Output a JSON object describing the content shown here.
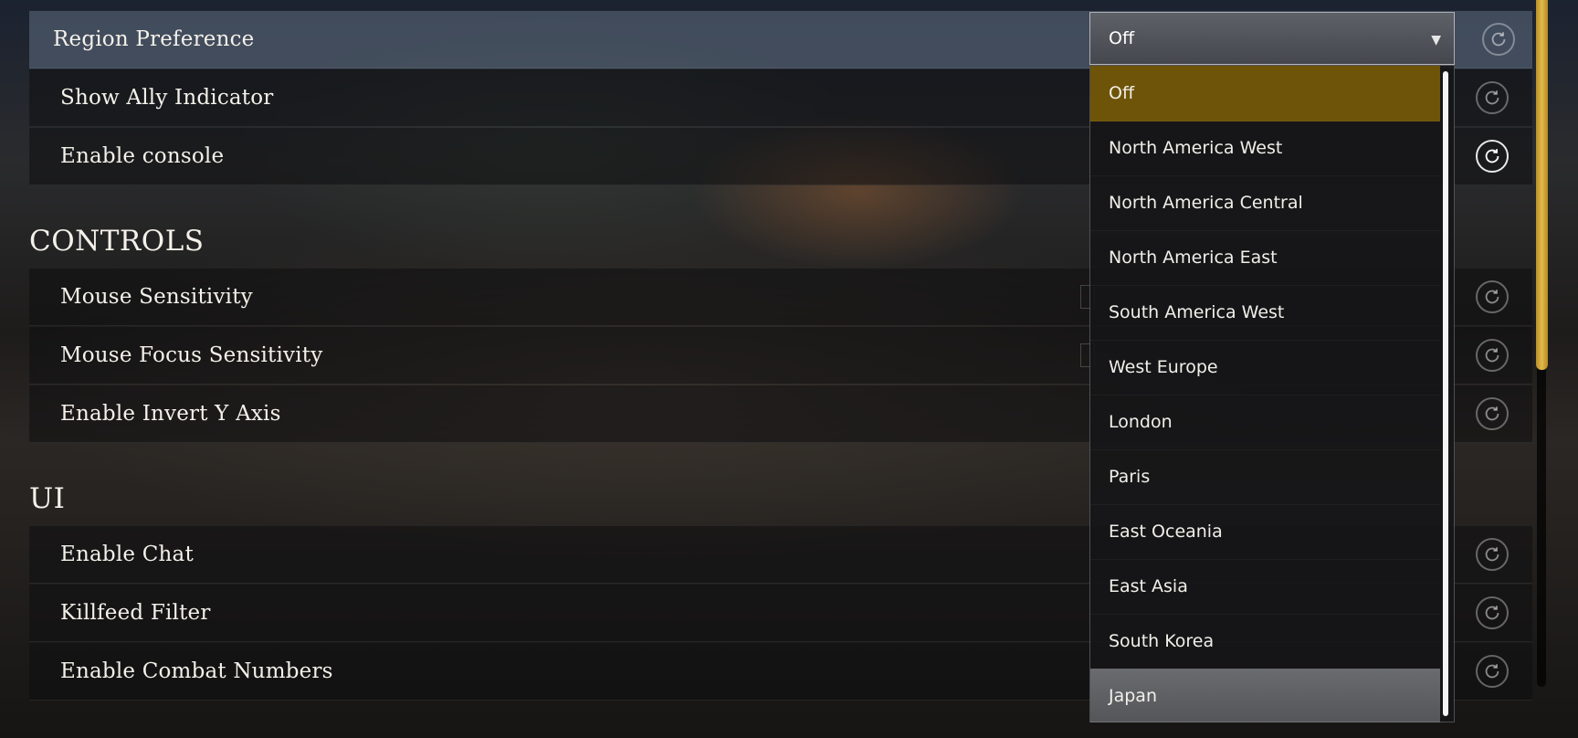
{
  "settings": {
    "region_preference": {
      "label": "Region Preference",
      "value": "Off"
    },
    "show_ally_indicator": {
      "label": "Show Ally Indicator"
    },
    "enable_console": {
      "label": "Enable console"
    }
  },
  "sections": {
    "controls": {
      "title": "CONTROLS",
      "mouse_sensitivity": "Mouse Sensitivity",
      "mouse_focus_sensitivity": "Mouse Focus Sensitivity",
      "enable_invert_y": "Enable Invert Y Axis"
    },
    "ui": {
      "title": "UI",
      "enable_chat": "Enable Chat",
      "killfeed_filter": "Killfeed Filter",
      "enable_combat_numbers": "Enable Combat Numbers"
    }
  },
  "dropdown": {
    "selected": "Off",
    "hovered": "Japan",
    "caret_icon": "caret-down-icon",
    "options": [
      "Off",
      "North America West",
      "North America Central",
      "North America East",
      "South America West",
      "West Europe",
      "London",
      "Paris",
      "East Oceania",
      "East Asia",
      "South Korea",
      "Japan"
    ]
  },
  "icons": {
    "reset": "reset-icon"
  },
  "colors": {
    "selected_option": "#6e5408",
    "active_row": "#5f6e82",
    "scrollbar_thumb": "#e2b94a"
  }
}
